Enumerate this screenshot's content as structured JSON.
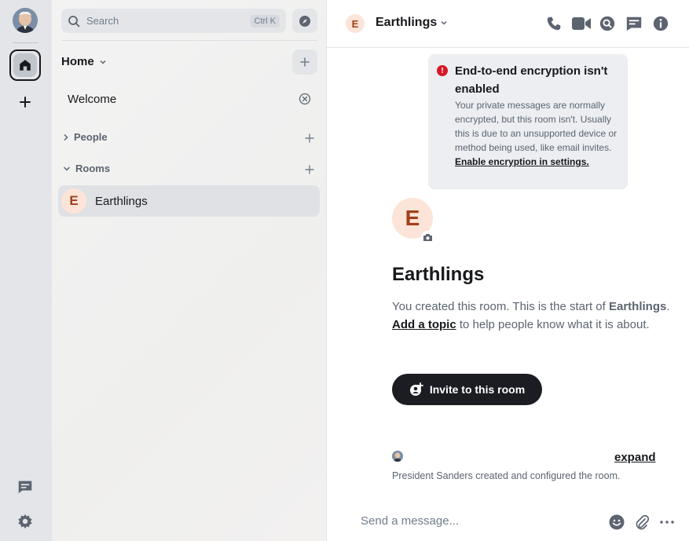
{
  "spaces": {
    "home_label": "Home",
    "add_label": "Create a space",
    "threads_label": "Threads",
    "settings_label": "Quick settings"
  },
  "roomlist": {
    "search": {
      "label": "Search",
      "shortcut": "Ctrl K"
    },
    "home_title": "Home",
    "welcome": "Welcome",
    "sections": {
      "people": "People",
      "rooms": "Rooms"
    },
    "rooms": [
      {
        "initial": "E",
        "name": "Earthlings"
      }
    ]
  },
  "header": {
    "initial": "E",
    "room_name": "Earthlings"
  },
  "e2e_notice": {
    "title": "End-to-end encryption isn't enabled",
    "body": "Your private messages are normally encrypted, but this room isn't. Usually this is due to an unsupported device or method being used, like email invites. ",
    "link": "Enable encryption in settings."
  },
  "room_intro": {
    "initial": "E",
    "title": "Earthlings",
    "created_prefix": "You created this room. This is the start of ",
    "room_name": "Earthlings",
    "created_suffix": ".",
    "topic_link": "Add a topic",
    "topic_suffix": " to help people know what it is about."
  },
  "invite_button": "Invite to this room",
  "event": {
    "expand": "expand",
    "text": "President Sanders created and configured the room."
  },
  "composer": {
    "placeholder": "Send a message..."
  },
  "colors": {
    "accent": "#1b1d22",
    "room_avatar_bg": "#fde4d9",
    "room_avatar_fg": "#a03f18",
    "warning": "#d51928"
  }
}
